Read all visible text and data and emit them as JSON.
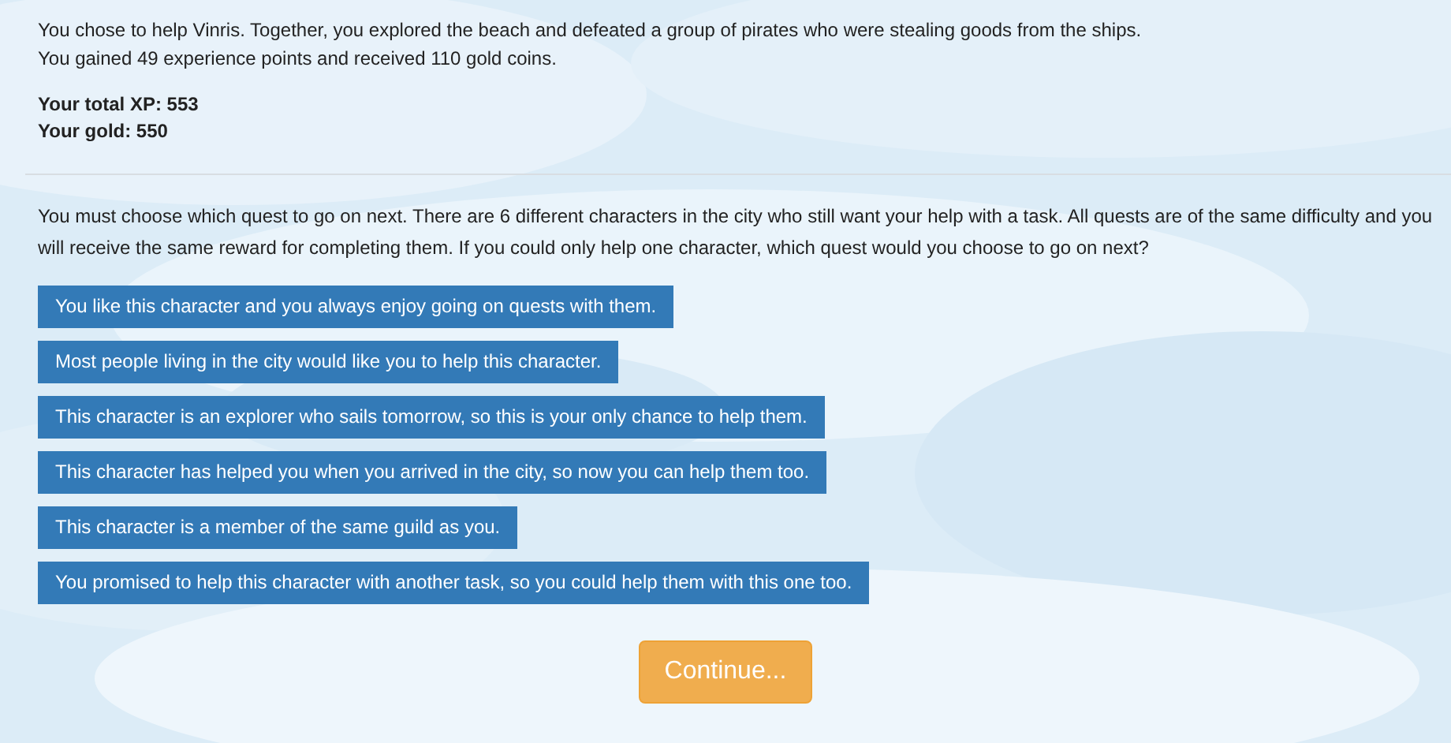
{
  "result": {
    "lines": [
      "You chose to help Vinris. Together, you explored the beach and defeated a group of pirates who were stealing goods from the ships.",
      "You gained 49 experience points and received 110 gold coins."
    ]
  },
  "stats": [
    "Your total XP: 553",
    "Your gold: 550"
  ],
  "question": "You must choose which quest to go on next. There are 6 different characters in the city who still want your help with a task. All quests are of the same difficulty and you will receive the same reward for completing them. If you could only help one character, which quest would you choose to go on next?",
  "options": [
    {
      "label": "You like this character and you always enjoy going on quests with them.",
      "selected": false
    },
    {
      "label": "Most people living in the city would like you to help this character.",
      "selected": false
    },
    {
      "label": "This character is an explorer who sails tomorrow, so this is your only chance to help them.",
      "selected": false
    },
    {
      "label": "This character has helped you when you arrived in the city, so now you can help them too.",
      "selected": false
    },
    {
      "label": "This character is a member of the same guild as you.",
      "selected": false
    },
    {
      "label": "You promised to help this character with another task, so you could help them with this one too.",
      "selected": false
    }
  ],
  "continue_button": "Continue..."
}
